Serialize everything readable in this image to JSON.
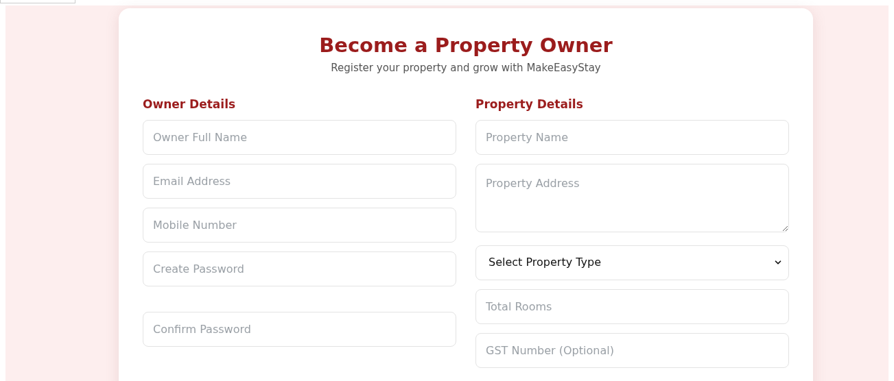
{
  "title": "Become a Property Owner",
  "subtitle": "Register your property and grow with MakeEasyStay",
  "sections": [
    {
      "heading": "Owner Details",
      "fields": [
        {
          "kind": "input",
          "placeholder": "Owner Full Name"
        },
        {
          "kind": "input",
          "placeholder": "Email Address"
        },
        {
          "kind": "input",
          "placeholder": "Mobile Number"
        },
        {
          "kind": "input",
          "placeholder": "Create Password"
        },
        {
          "kind": "input",
          "placeholder": "Confirm Password"
        }
      ]
    },
    {
      "heading": "Property Details",
      "fields": [
        {
          "kind": "input",
          "placeholder": "Property Name"
        },
        {
          "kind": "textarea",
          "placeholder": "Property Address"
        },
        {
          "kind": "select",
          "value": "Select Property Type"
        },
        {
          "kind": "input",
          "placeholder": "Total Rooms"
        },
        {
          "kind": "input",
          "placeholder": "GST Number (Optional)"
        }
      ]
    }
  ]
}
